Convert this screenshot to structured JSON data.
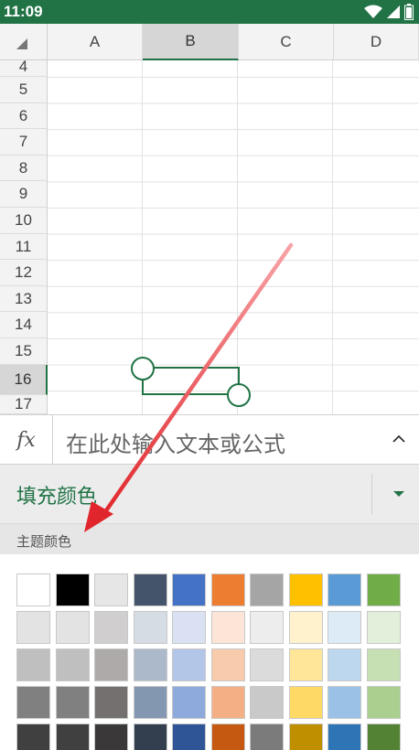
{
  "status_bar": {
    "time": "11:09",
    "icons": [
      "wifi-icon",
      "signal-icon",
      "battery-icon"
    ]
  },
  "sheet": {
    "columns": [
      "A",
      "B",
      "C",
      "D"
    ],
    "selected_column": "B",
    "rows": [
      "4",
      "5",
      "6",
      "7",
      "8",
      "9",
      "10",
      "11",
      "12",
      "13",
      "14",
      "15",
      "16",
      "17"
    ],
    "selected_row": "16"
  },
  "formula_bar": {
    "fx_label": "fx",
    "placeholder": "在此处输入文本或公式"
  },
  "fill_panel": {
    "title": "填充颜色",
    "theme_section_label": "主题颜色",
    "palette": [
      [
        "#ffffff",
        "#000000",
        "#e7e6e6",
        "#44546a",
        "#4472c4",
        "#ed7d31",
        "#a5a5a5",
        "#ffc000",
        "#5b9bd5",
        "#70ad47"
      ],
      [
        "#e3e3e3",
        "#e3e3e3",
        "#d0cece",
        "#d6dce4",
        "#d9e1f2",
        "#fce4d6",
        "#ededed",
        "#fff2cc",
        "#ddebf7",
        "#e2efda"
      ],
      [
        "#bfbfbf",
        "#bfbfbf",
        "#aeaaaa",
        "#acb9ca",
        "#b4c6e7",
        "#f8cbad",
        "#dbdbdb",
        "#ffe699",
        "#bdd7ee",
        "#c6e0b4"
      ],
      [
        "#808080",
        "#808080",
        "#747070",
        "#8497b0",
        "#8ea9db",
        "#f4b084",
        "#c9c9c9",
        "#ffd966",
        "#9bc2e6",
        "#a9d08e"
      ],
      [
        "#404040",
        "#404040",
        "#3a3838",
        "#333f4f",
        "#2f5597",
        "#c65911",
        "#7b7b7b",
        "#bf8f00",
        "#2e75b6",
        "#548235"
      ]
    ]
  },
  "colors": {
    "accent": "#217346",
    "annotation_arrow": "#e0262c"
  }
}
